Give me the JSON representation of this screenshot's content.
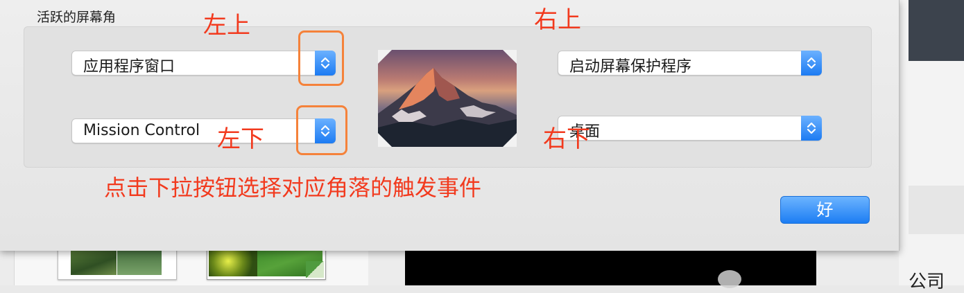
{
  "screen": {
    "section_title": "活跃的屏幕角",
    "corners": {
      "top_left": {
        "value": "应用程序窗口",
        "annotation": "左上"
      },
      "top_right": {
        "value": "启动屏幕保护程序",
        "annotation": "右上"
      },
      "bottom_left": {
        "value": "Mission Control",
        "annotation": "左下"
      },
      "bottom_right": {
        "value": "桌面",
        "annotation": "右下"
      }
    },
    "hint": "点击下拉按钮选择对应角落的触发事件",
    "ok_label": "好",
    "background_partial_text": "公司"
  },
  "icons": {
    "stepper": "up-down-chevron-icon",
    "corner_marker": "corner-triangle-icon",
    "preview": "mountain-wallpaper-preview"
  },
  "colors": {
    "accent": "#1c7df3",
    "annotation": "#f23a1e",
    "highlight_box": "#f5823a"
  }
}
